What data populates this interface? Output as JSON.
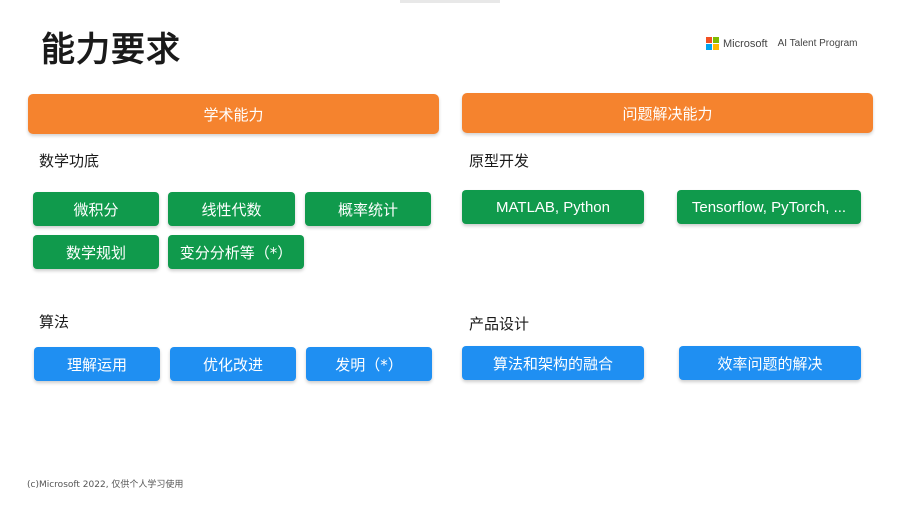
{
  "title": "能力要求",
  "brand": {
    "company": "Microsoft",
    "program": "AI Talent Program",
    "logo_colors": [
      "#f25022",
      "#7fba00",
      "#00a4ef",
      "#ffb900"
    ]
  },
  "colors": {
    "header_orange": "#f5832e",
    "chip_green": "#109a4c",
    "chip_blue": "#1f8ff2"
  },
  "left": {
    "header": "学术能力",
    "math": {
      "heading": "数学功底",
      "items": [
        "微积分",
        "线性代数",
        "概率统计",
        "数学规划",
        "变分分析等（*）"
      ]
    },
    "algo": {
      "heading": "算法",
      "items": [
        "理解运用",
        "优化改进",
        "发明（*）"
      ]
    }
  },
  "right": {
    "header": "问题解决能力",
    "proto": {
      "heading": "原型开发",
      "items": [
        "MATLAB, Python",
        "Tensorflow, PyTorch, ..."
      ]
    },
    "product": {
      "heading": "产品设计",
      "items": [
        "算法和架构的融合",
        "效率问题的解决"
      ]
    }
  },
  "footer": "(c)Microsoft 2022, 仅供个人学习使用"
}
